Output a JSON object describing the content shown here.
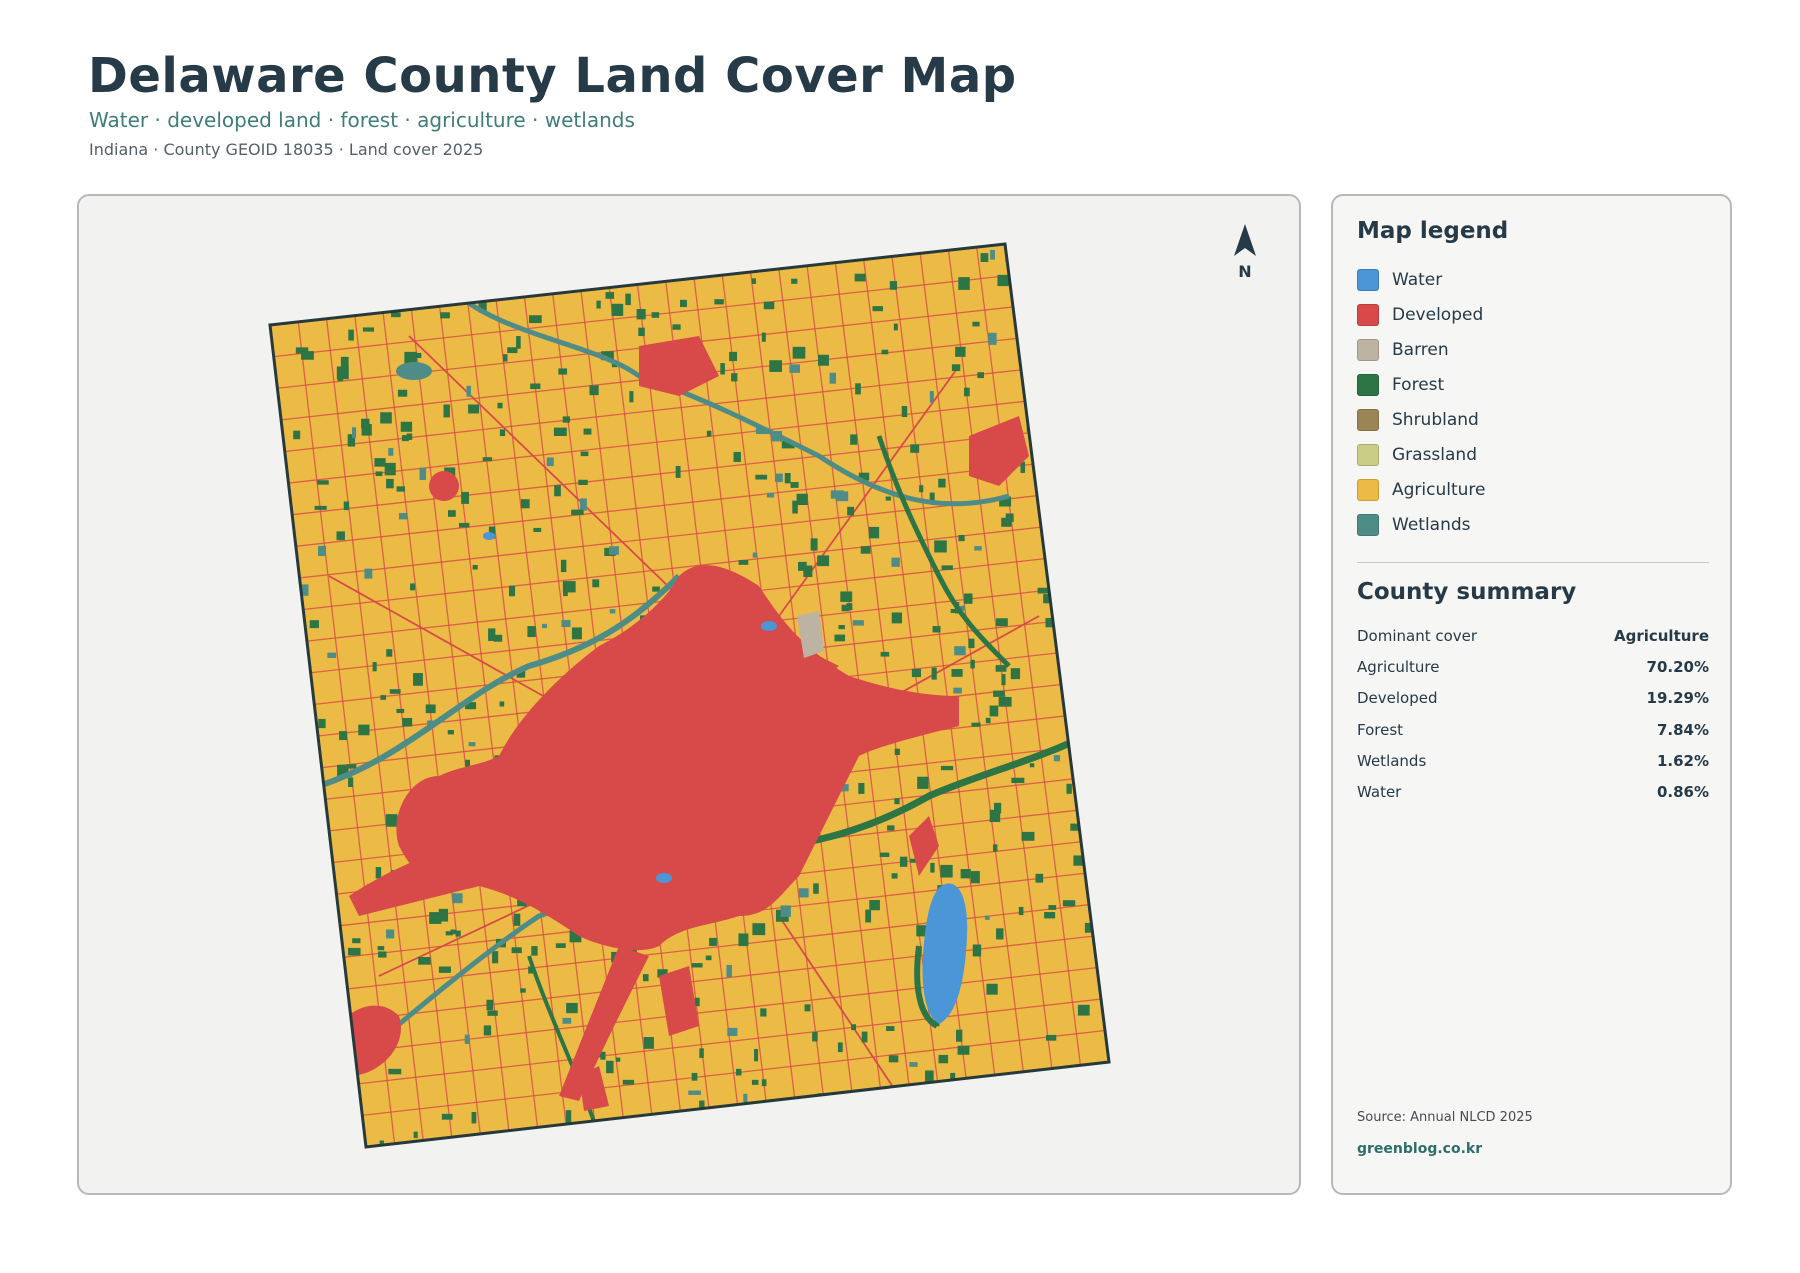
{
  "header": {
    "title": "Delaware County Land Cover Map",
    "subtitle": "Water · developed land · forest · agriculture · wetlands",
    "meta": "Indiana · County GEOID 18035 · Land cover 2025"
  },
  "map": {
    "north_label": "N",
    "icon": "north-arrow-icon",
    "colors": {
      "water": "#4a96d6",
      "developed": "#d84a49",
      "barren": "#bdb3a3",
      "forest": "#2d7545",
      "shrubland": "#9a8555",
      "grassland": "#c9cd85",
      "agriculture": "#ecbb45",
      "wetlands": "#4e8d87",
      "boundary": "#263a3c"
    }
  },
  "legend": {
    "title": "Map legend",
    "items": [
      {
        "label": "Water",
        "color": "#4a96d6"
      },
      {
        "label": "Developed",
        "color": "#d84a49"
      },
      {
        "label": "Barren",
        "color": "#bdb3a3"
      },
      {
        "label": "Forest",
        "color": "#2d7545"
      },
      {
        "label": "Shrubland",
        "color": "#9a8555"
      },
      {
        "label": "Grassland",
        "color": "#c9cd85"
      },
      {
        "label": "Agriculture",
        "color": "#ecbb45"
      },
      {
        "label": "Wetlands",
        "color": "#4e8d87"
      }
    ]
  },
  "summary": {
    "title": "County summary",
    "rows": [
      {
        "key": "Dominant cover",
        "value": "Agriculture"
      },
      {
        "key": "Agriculture",
        "value": "70.20%"
      },
      {
        "key": "Developed",
        "value": "19.29%"
      },
      {
        "key": "Forest",
        "value": "7.84%"
      },
      {
        "key": "Wetlands",
        "value": "1.62%"
      },
      {
        "key": "Water",
        "value": "0.86%"
      }
    ]
  },
  "footer": {
    "source": "Source: Annual NLCD 2025",
    "site": "greenblog.co.kr"
  }
}
